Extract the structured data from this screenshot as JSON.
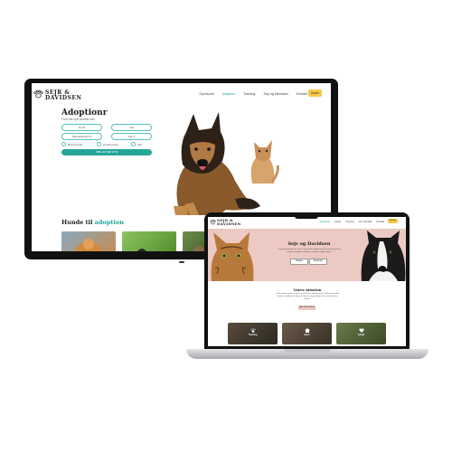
{
  "desktop": {
    "logo": {
      "line1": "SEJR &",
      "line2": "DAVIDSEN"
    },
    "nav": [
      "Sponsorer",
      "Adoption",
      "Træning",
      "Sejr og Davidsen",
      "Kontakt"
    ],
    "nav_active": 1,
    "cta": "Doner",
    "page_title": "Adoptionr",
    "page_sub": "Find din nye bedste ven",
    "filters": {
      "row1": [
        "Hund",
        "Kat"
      ],
      "row2": [
        "Alderskategori ▾",
        "Køn ▾"
      ],
      "radios": [
        "Børnevenlig",
        "Hundevenlig",
        "Alle"
      ],
      "search": "SØG EFTER DYR"
    },
    "section_title_prefix": "Hunde til ",
    "section_title_highlight": "adoption"
  },
  "laptop": {
    "logo": {
      "line1": "SEJR &",
      "line2": "DAVIDSEN"
    },
    "nav": [
      "Sponsorer",
      "Adopt",
      "Træning",
      "Om os/Udda",
      "Kontakt"
    ],
    "nav_active": 0,
    "cta": "Doner",
    "hero": {
      "title": "Sejr og Davidsen",
      "text": "Lorem ipsum dolor sit amet, consectetur adipiscing elit, sed do eiusmod tempor incididunt ut labore et dolore magna aliqua.",
      "btn1": "Adopter",
      "btn2": "Sponsorer"
    },
    "mission": {
      "title": "Vores mission",
      "text": "Lorem ipsum dolor sit amet, consectetur adipiscing elit. Sed do eiusmod tempor incididunt ut labore et dolore magna aliqua. Ut enim ad minim veniam.",
      "button": "Læs mere om os"
    },
    "cards": [
      "Træning",
      "Hjem",
      "Adopt"
    ]
  },
  "colors": {
    "accent": "#26a69a",
    "cta": "#f6c84a",
    "hero_pink": "#ecc9c2"
  }
}
